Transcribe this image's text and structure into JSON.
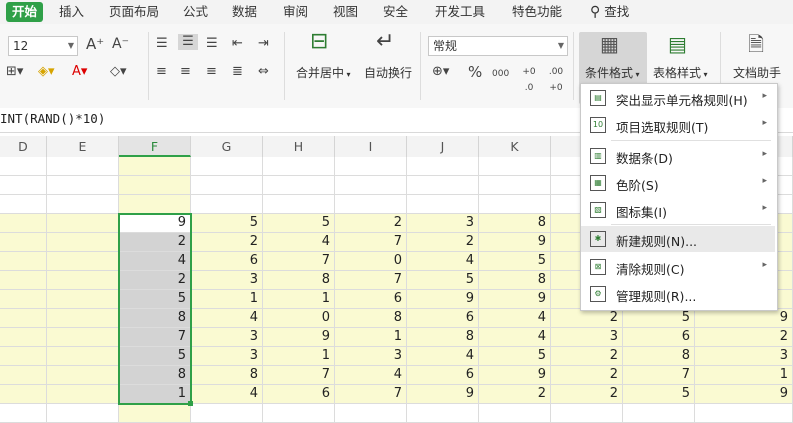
{
  "menu": {
    "tabs": [
      "开始",
      "插入",
      "页面布局",
      "公式",
      "数据",
      "审阅",
      "视图",
      "安全",
      "开发工具",
      "特色功能"
    ],
    "search": "查找"
  },
  "ribbon": {
    "font_size": "12",
    "number_format": "常规",
    "merge_label": "合并居中",
    "wrap_label": "自动换行",
    "cond_format_label": "条件格式",
    "table_style_label": "表格样式",
    "doc_helper_label": "文档助手",
    "percent": "%",
    "thousands": "000",
    "inc_dec": "+0 .0",
    "dec_dec": ".00 +0"
  },
  "formula_bar": {
    "text": "INT(RAND()*10)"
  },
  "columns": [
    "D",
    "E",
    "F",
    "G",
    "H",
    "I",
    "J",
    "K"
  ],
  "selected_column": "F",
  "rows": [
    {
      "F": 9,
      "G": 5,
      "H": 5,
      "I": 2,
      "J": 3,
      "K": 8
    },
    {
      "F": 2,
      "G": 2,
      "H": 4,
      "I": 7,
      "J": 2,
      "K": 9
    },
    {
      "F": 4,
      "G": 6,
      "H": 7,
      "I": 0,
      "J": 4,
      "K": 5
    },
    {
      "F": 2,
      "G": 3,
      "H": 8,
      "I": 7,
      "J": 5,
      "K": 8
    },
    {
      "F": 5,
      "G": 1,
      "H": 1,
      "I": 6,
      "J": 9,
      "K": 9
    },
    {
      "F": 8,
      "G": 4,
      "H": 0,
      "I": 8,
      "J": 6,
      "K": 4,
      "L": 2,
      "M": 5,
      "N": 9
    },
    {
      "F": 7,
      "G": 3,
      "H": 9,
      "I": 1,
      "J": 8,
      "K": 4,
      "L": 3,
      "M": 6,
      "N": 2
    },
    {
      "F": 5,
      "G": 3,
      "H": 1,
      "I": 3,
      "J": 4,
      "K": 5,
      "L": 2,
      "M": 8,
      "N": 3
    },
    {
      "F": 8,
      "G": 8,
      "H": 7,
      "I": 4,
      "J": 6,
      "K": 9,
      "L": 2,
      "M": 7,
      "N": 1
    },
    {
      "F": 1,
      "G": 4,
      "H": 6,
      "I": 7,
      "J": 9,
      "K": 2,
      "L": 2,
      "M": 5,
      "N": 9
    }
  ],
  "dropdown": {
    "items": [
      {
        "label": "突出显示单元格规则(H)",
        "submenu": true,
        "icon": "highlight-rules-icon"
      },
      {
        "label": "项目选取规则(T)",
        "submenu": true,
        "icon": "top-bottom-rules-icon"
      },
      {
        "label": "数据条(D)",
        "submenu": true,
        "icon": "data-bars-icon"
      },
      {
        "label": "色阶(S)",
        "submenu": true,
        "icon": "color-scales-icon"
      },
      {
        "label": "图标集(I)",
        "submenu": true,
        "icon": "icon-sets-icon"
      },
      {
        "label": "新建规则(N)...",
        "submenu": false,
        "icon": "new-rule-icon"
      },
      {
        "label": "清除规则(C)",
        "submenu": true,
        "icon": "clear-rules-icon"
      },
      {
        "label": "管理规则(R)...",
        "submenu": false,
        "icon": "manage-rules-icon"
      }
    ],
    "highlighted_index": 5,
    "submenu_arrow": "▸"
  },
  "colors": {
    "accent": "#2fa048",
    "yellow_band": "#fafad2",
    "selection_fill": "#d3d3d3"
  }
}
